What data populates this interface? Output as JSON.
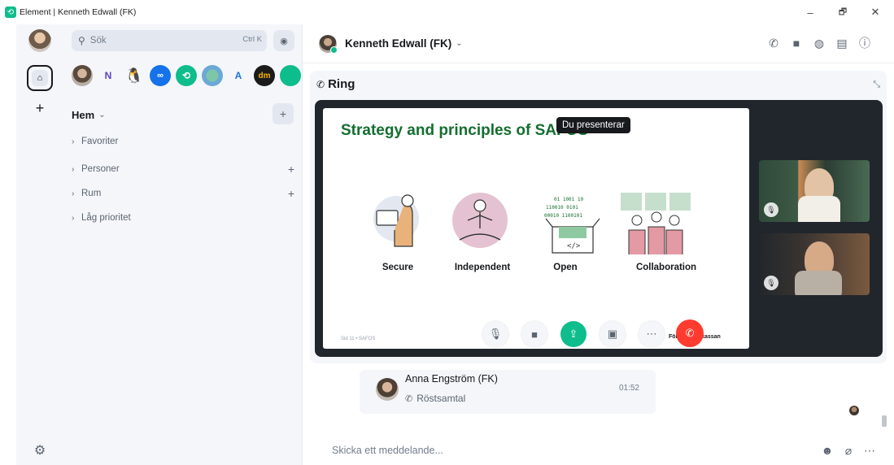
{
  "window": {
    "title": "Element | Kenneth Edwall (FK)",
    "minimize": "–",
    "restore": "🗗",
    "close": "✕"
  },
  "spacebar": {
    "add_label": "+",
    "home_glyph": "⌂"
  },
  "roomlist": {
    "search_placeholder": "Sök",
    "search_shortcut": "Ctrl K",
    "spaces": [
      {
        "name": "avatar",
        "glyph": ""
      },
      {
        "name": "n",
        "glyph": "N"
      },
      {
        "name": "tux",
        "glyph": "🐧"
      },
      {
        "name": "blue",
        "glyph": "∞"
      },
      {
        "name": "element",
        "glyph": "⟲"
      },
      {
        "name": "globe",
        "glyph": ""
      },
      {
        "name": "a",
        "glyph": "A"
      },
      {
        "name": "dm",
        "glyph": "dm"
      }
    ],
    "home_label": "Hem",
    "home_add": "+",
    "sections": [
      {
        "label": "Favoriter",
        "has_add": false
      },
      {
        "label": "Personer",
        "has_add": true
      },
      {
        "label": "Rum",
        "has_add": true
      },
      {
        "label": "Låg prioritet",
        "has_add": false
      }
    ]
  },
  "room": {
    "name": "Kenneth Edwall (FK)",
    "header_icons": [
      "phone-icon",
      "video-icon",
      "threads-icon",
      "chat-icon",
      "info-icon"
    ]
  },
  "call": {
    "title": "Ring",
    "tooltip": "Du presenterar",
    "slide": {
      "title": "Strategy and principles of SAFOS",
      "principles": [
        "Secure",
        "Independent",
        "Open",
        "Collaboration"
      ],
      "footer_left": "Sid 11 • SAFOS",
      "footer_right": "Försäkringskassan"
    }
  },
  "timeline": {
    "sender": "Anna Engström (FK)",
    "time": "01:52",
    "call_label": "Röstsamtal"
  },
  "composer": {
    "placeholder": "Skicka ett meddelande..."
  },
  "colors": {
    "accent": "#0dbd8b",
    "hangup": "#ff3b30",
    "slide_title": "#146e2f"
  }
}
